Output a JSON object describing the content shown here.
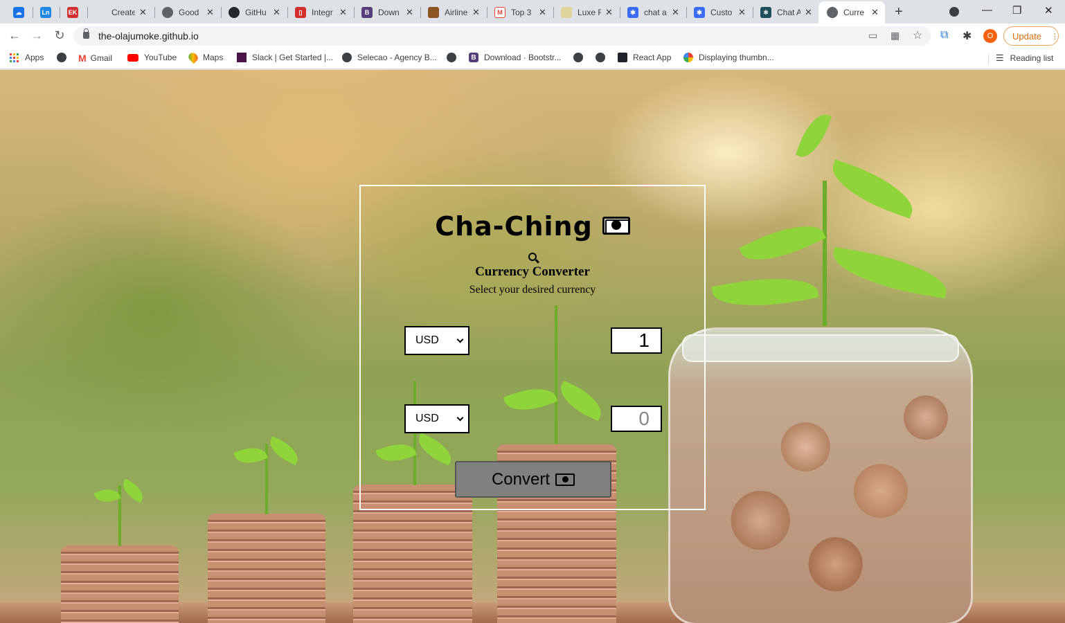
{
  "browser": {
    "tabs": [
      {
        "title": "",
        "favicon": "cloud-icon",
        "color": "#1a73e8"
      },
      {
        "title": "",
        "favicon": "ln-icon",
        "color": "#1e88e5"
      },
      {
        "title": "",
        "favicon": "ek-icon",
        "color": "#d32f2f"
      },
      {
        "title": "Create",
        "favicon": "blank-icon",
        "color": "#ffffff"
      },
      {
        "title": "Good",
        "favicon": "globe-icon",
        "color": "#5f6368"
      },
      {
        "title": "GitHu",
        "favicon": "github-icon",
        "color": "#24292e"
      },
      {
        "title": "Integr",
        "favicon": "integr-icon",
        "color": "#d32f2f"
      },
      {
        "title": "Down",
        "favicon": "bootstrap-icon",
        "color": "#563d7c"
      },
      {
        "title": "Airline",
        "favicon": "airline-icon",
        "color": "#8d5524"
      },
      {
        "title": "Top 3",
        "favicon": "gmail-icon",
        "color": "#ea4335"
      },
      {
        "title": "Luxe F",
        "favicon": "luxe-icon",
        "color": "#e0d49a"
      },
      {
        "title": "chat a",
        "favicon": "puzzle-icon",
        "color": "#3b6cf6"
      },
      {
        "title": "Custo",
        "favicon": "puzzle-icon",
        "color": "#3b6cf6"
      },
      {
        "title": "Chat A",
        "favicon": "react-icon",
        "color": "#1f4f5a"
      },
      {
        "title": "Curre",
        "favicon": "globe-icon",
        "color": "#5f6368",
        "active": true
      }
    ],
    "url": "the-olajumoke.github.io",
    "profile_initial": "O",
    "update_label": "Update",
    "bookmarks": [
      {
        "label": "Apps",
        "icon": "apps-grid-icon"
      },
      {
        "label": "",
        "icon": "globe-icon"
      },
      {
        "label": "Gmail",
        "icon": "gmail-icon"
      },
      {
        "label": "YouTube",
        "icon": "youtube-icon"
      },
      {
        "label": "Maps",
        "icon": "maps-icon"
      },
      {
        "label": "Slack | Get Started |...",
        "icon": "slack-icon"
      },
      {
        "label": "Selecao - Agency B...",
        "icon": "globe-icon"
      },
      {
        "label": "",
        "icon": "globe-icon"
      },
      {
        "label": "Download · Bootstr...",
        "icon": "bootstrap-icon"
      },
      {
        "label": "",
        "icon": "globe-icon"
      },
      {
        "label": "",
        "icon": "globe-icon"
      },
      {
        "label": "React App",
        "icon": "react-icon"
      },
      {
        "label": "Displaying thumbn...",
        "icon": "photos-icon"
      }
    ],
    "reading_list": "Reading list"
  },
  "app": {
    "title": "Cha-Ching",
    "subtitle": "Currency Converter",
    "hint": "Select your desired currency",
    "from": {
      "currency": "USD",
      "amount": "1"
    },
    "to": {
      "currency": "USD",
      "amount": "0"
    },
    "convert_label": "Convert"
  }
}
